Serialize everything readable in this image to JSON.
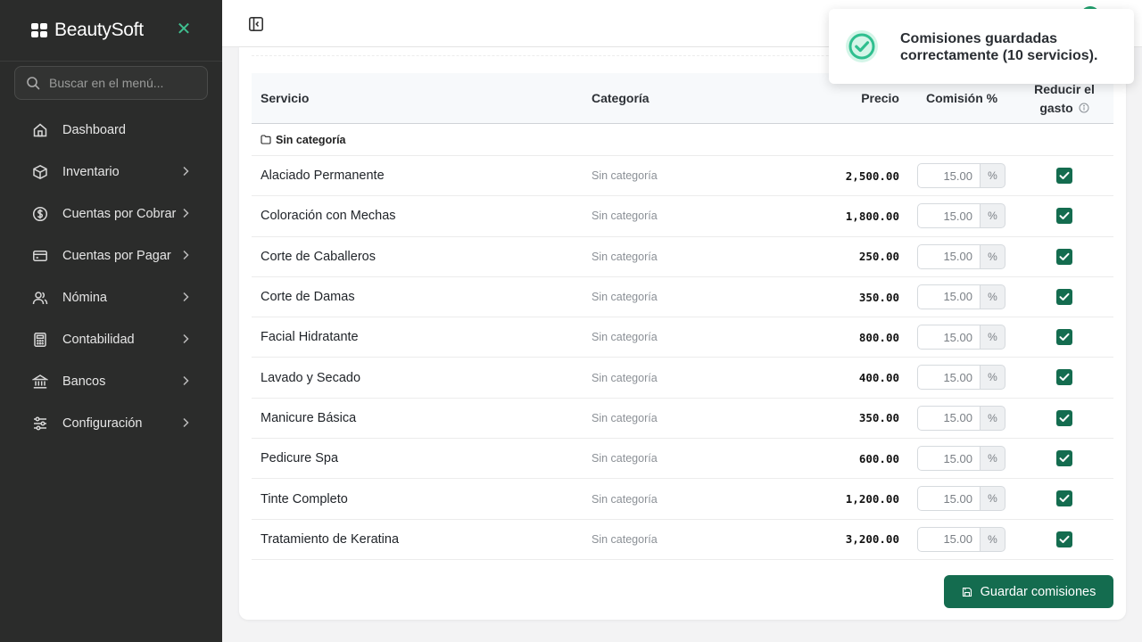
{
  "brand": {
    "name": "BeautySoft",
    "close_glyph": "✕"
  },
  "search": {
    "placeholder": "Buscar en el menú..."
  },
  "sidebar": {
    "items": [
      {
        "label": "Dashboard",
        "icon": "home-icon",
        "has_children": false
      },
      {
        "label": "Inventario",
        "icon": "box-icon",
        "has_children": true
      },
      {
        "label": "Cuentas por Cobrar",
        "icon": "dollar-circle-icon",
        "has_children": true
      },
      {
        "label": "Cuentas por Pagar",
        "icon": "credit-card-icon",
        "has_children": true
      },
      {
        "label": "Nómina",
        "icon": "users-icon",
        "has_children": true
      },
      {
        "label": "Contabilidad",
        "icon": "calculator-icon",
        "has_children": true
      },
      {
        "label": "Bancos",
        "icon": "bank-icon",
        "has_children": true
      },
      {
        "label": "Configuración",
        "icon": "sliders-icon",
        "has_children": true
      }
    ]
  },
  "table": {
    "headers": {
      "service": "Servicio",
      "category": "Categoría",
      "price": "Precio",
      "commission": "Comisión %",
      "reduce_line1": "Reducir el",
      "reduce_line2": "gasto"
    },
    "group_label": "Sin categoría",
    "rows": [
      {
        "service": "Alaciado Permanente",
        "category": "Sin categoría",
        "price": "2,500.00",
        "commission": "15.00",
        "unit": "%",
        "reduce": true
      },
      {
        "service": "Coloración con Mechas",
        "category": "Sin categoría",
        "price": "1,800.00",
        "commission": "15.00",
        "unit": "%",
        "reduce": true
      },
      {
        "service": "Corte de Caballeros",
        "category": "Sin categoría",
        "price": "250.00",
        "commission": "15.00",
        "unit": "%",
        "reduce": true
      },
      {
        "service": "Corte de Damas",
        "category": "Sin categoría",
        "price": "350.00",
        "commission": "15.00",
        "unit": "%",
        "reduce": true
      },
      {
        "service": "Facial Hidratante",
        "category": "Sin categoría",
        "price": "800.00",
        "commission": "15.00",
        "unit": "%",
        "reduce": true
      },
      {
        "service": "Lavado y Secado",
        "category": "Sin categoría",
        "price": "400.00",
        "commission": "15.00",
        "unit": "%",
        "reduce": true
      },
      {
        "service": "Manicure Básica",
        "category": "Sin categoría",
        "price": "350.00",
        "commission": "15.00",
        "unit": "%",
        "reduce": true
      },
      {
        "service": "Pedicure Spa",
        "category": "Sin categoría",
        "price": "600.00",
        "commission": "15.00",
        "unit": "%",
        "reduce": true
      },
      {
        "service": "Tinte Completo",
        "category": "Sin categoría",
        "price": "1,200.00",
        "commission": "15.00",
        "unit": "%",
        "reduce": true
      },
      {
        "service": "Tratamiento de Keratina",
        "category": "Sin categoría",
        "price": "3,200.00",
        "commission": "15.00",
        "unit": "%",
        "reduce": true
      }
    ]
  },
  "actions": {
    "save_label": "Guardar comisiones"
  },
  "toast": {
    "message": "Comisiones guardadas correctamente (10 servicios)."
  },
  "colors": {
    "sidebar_bg": "#2b2c2b",
    "accent": "#146c4f",
    "success": "#2fbf8f"
  }
}
